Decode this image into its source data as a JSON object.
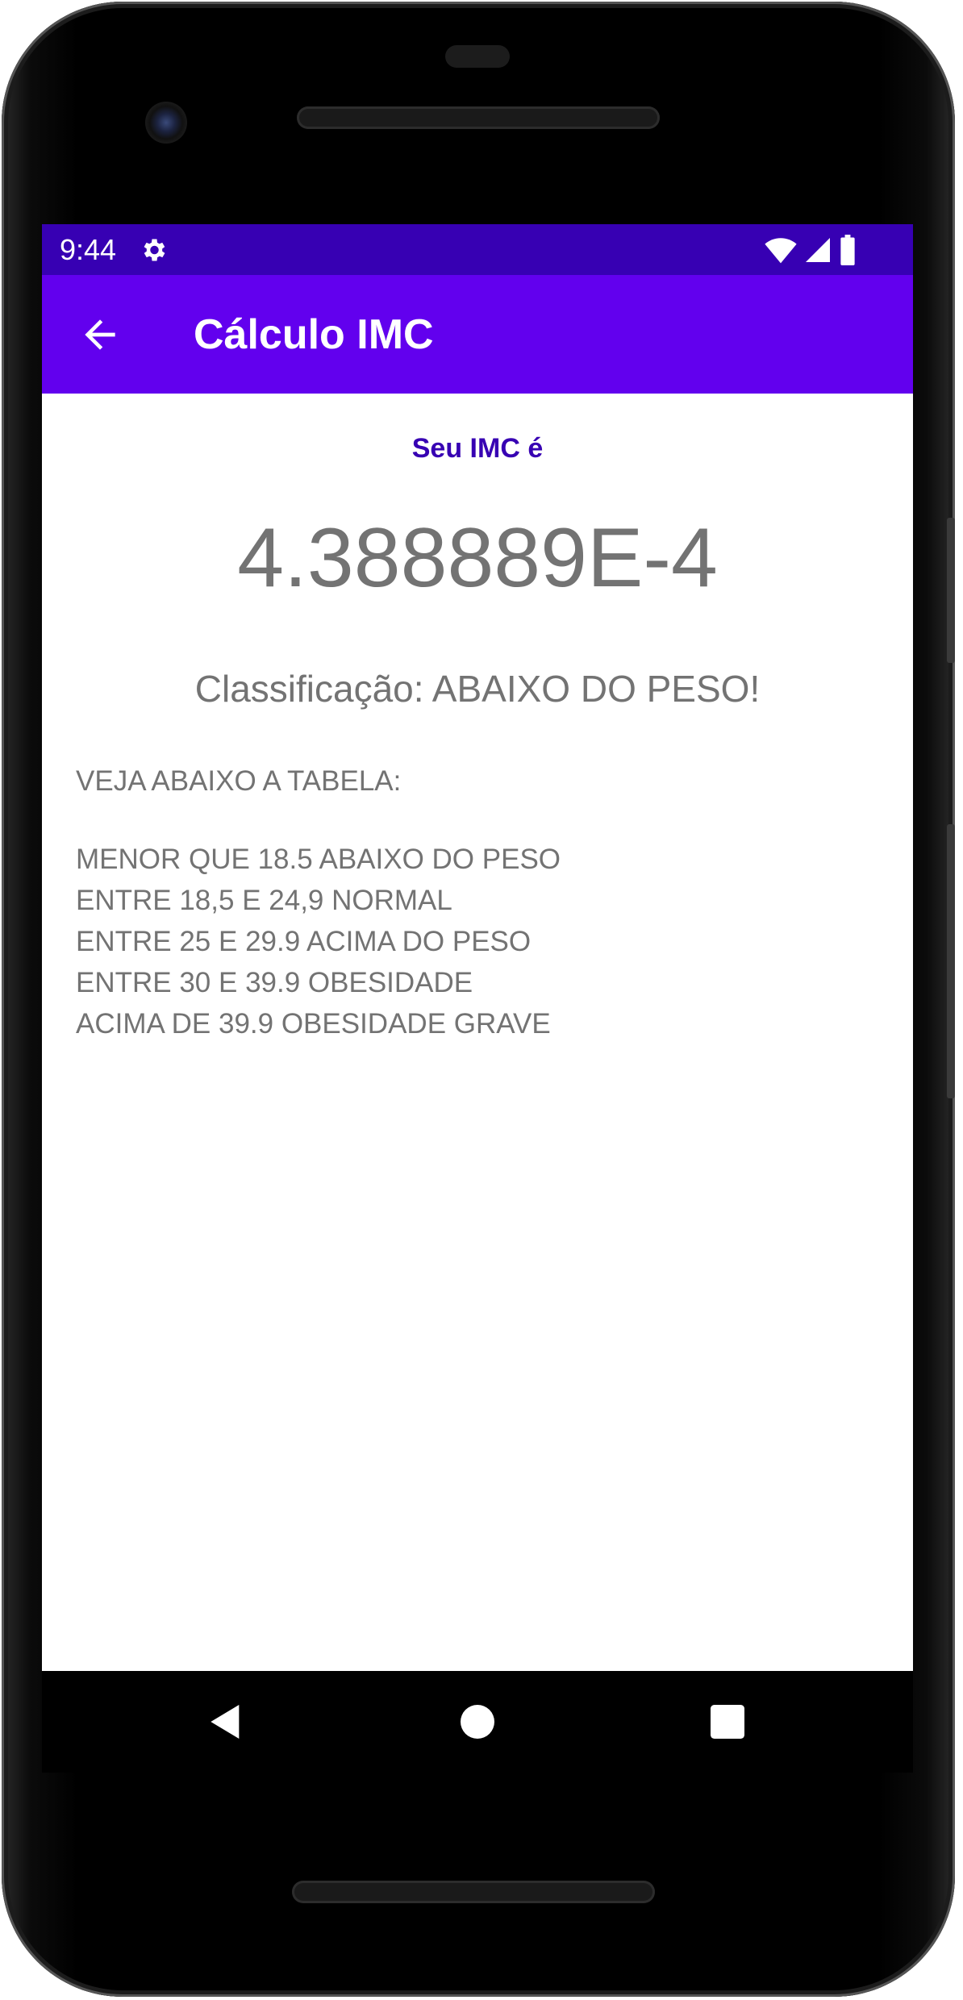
{
  "status_bar": {
    "time": "9:44",
    "icons": [
      "gear-icon",
      "wifi-icon",
      "signal-icon",
      "battery-icon"
    ],
    "color": "#3700b3"
  },
  "app_bar": {
    "title": "Cálculo IMC",
    "back_icon": "arrow-left-icon",
    "color": "#6200ee"
  },
  "result": {
    "label": "Seu IMC é",
    "value": "4.388889E-4",
    "classification": "Classificação: ABAIXO DO PESO!"
  },
  "table": {
    "header": "VEJA ABAIXO A TABELA:",
    "rows": [
      "MENOR QUE 18.5 ABAIXO DO PESO",
      "ENTRE 18,5 E 24,9 NORMAL",
      "ENTRE 25 E 29.9 ACIMA DO PESO",
      "ENTRE 30 E 39.9 OBESIDADE",
      "ACIMA DE 39.9 OBESIDADE GRAVE"
    ]
  },
  "nav_bar": {
    "buttons": [
      "back-triangle-icon",
      "home-circle-icon",
      "recents-square-icon"
    ]
  },
  "colors": {
    "primary": "#6200ee",
    "primary_dark": "#3700b3",
    "text_gray": "#737373"
  }
}
